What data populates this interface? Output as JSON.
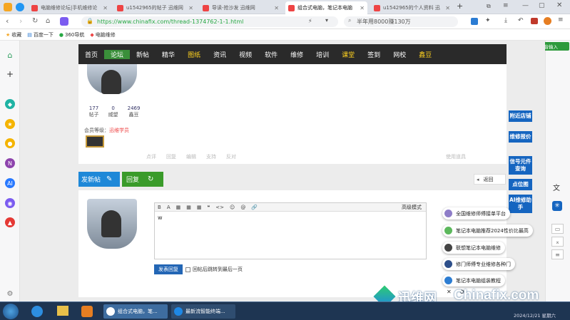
{
  "tabs": [
    {
      "label": "电脑维修论坛|手机维修论",
      "active": false,
      "color": "#e44"
    },
    {
      "label": "u1542965的帖子 迅维网",
      "active": false,
      "color": "#e44"
    },
    {
      "label": "导读-抢沙发 迅维网",
      "active": false,
      "color": "#e44"
    },
    {
      "label": "组合式电脑，笔记本电脑",
      "active": true,
      "color": "#e44"
    },
    {
      "label": "u1542965的个人资料 迅",
      "active": false,
      "color": "#e44"
    }
  ],
  "address": {
    "url": "https://www.chinafix.com/thread-1374762-1-1.html",
    "search": "半年用8000赚130万"
  },
  "bookmarks": [
    "收藏",
    "百度一下",
    "360导航",
    "电脑维修"
  ],
  "nav": [
    "首页",
    "论坛",
    "新帖",
    "精华",
    "图纸",
    "资讯",
    "视频",
    "软件",
    "维修",
    "培训",
    "课堂",
    "签到",
    "网校",
    "鑫豆"
  ],
  "nav_highlight": [
    "图纸",
    "课堂",
    "鑫豆"
  ],
  "nav_current": "论坛",
  "user": {
    "stats": [
      {
        "v": "177",
        "k": "帖子"
      },
      {
        "v": "0",
        "k": "威望"
      },
      {
        "v": "2469",
        "k": "鑫豆"
      }
    ],
    "level_label": "会员等级：",
    "level": "迅维学员"
  },
  "post_actions": [
    "点评",
    "回复",
    "编辑",
    "支持",
    "反对"
  ],
  "post_right": "使用道具",
  "buttons": {
    "new_post": "发新帖",
    "reply": "回复",
    "back": "返回"
  },
  "editor": {
    "toolbar": [
      "B",
      "A",
      "▦",
      "▦",
      "▦",
      "❝",
      "<>",
      "☺",
      "@",
      "🔗"
    ],
    "mode": "高级模式",
    "text": "w",
    "submit": "发表回复",
    "checkbox_label": "回帖后跳转到最后一页"
  },
  "side_links": [
    "附近店铺",
    "维修报价",
    "信号元件查询",
    "点位图",
    "AI维修助手"
  ],
  "popups": [
    "全国维修师傅接单平台",
    "笔记本电脑推荐2024性价比最高",
    "联想笔记本电脑维修",
    "修门师傅专业维修各种门",
    "笔记本电脑组装教程"
  ],
  "top_right_badge": "排音输入",
  "watermark": {
    "cn": "迅维网",
    "en": "Chinafix.com"
  },
  "taskbar": {
    "items": [
      "组合式电脑，笔...",
      "最新流智能终端..."
    ],
    "clock": "2024/12/21 星期六"
  },
  "colors": {
    "nav_bg": "#2a2a2a",
    "accent_blue": "#1e88d8",
    "accent_green": "#3a9b2a",
    "side_blue": "#1565c0"
  }
}
